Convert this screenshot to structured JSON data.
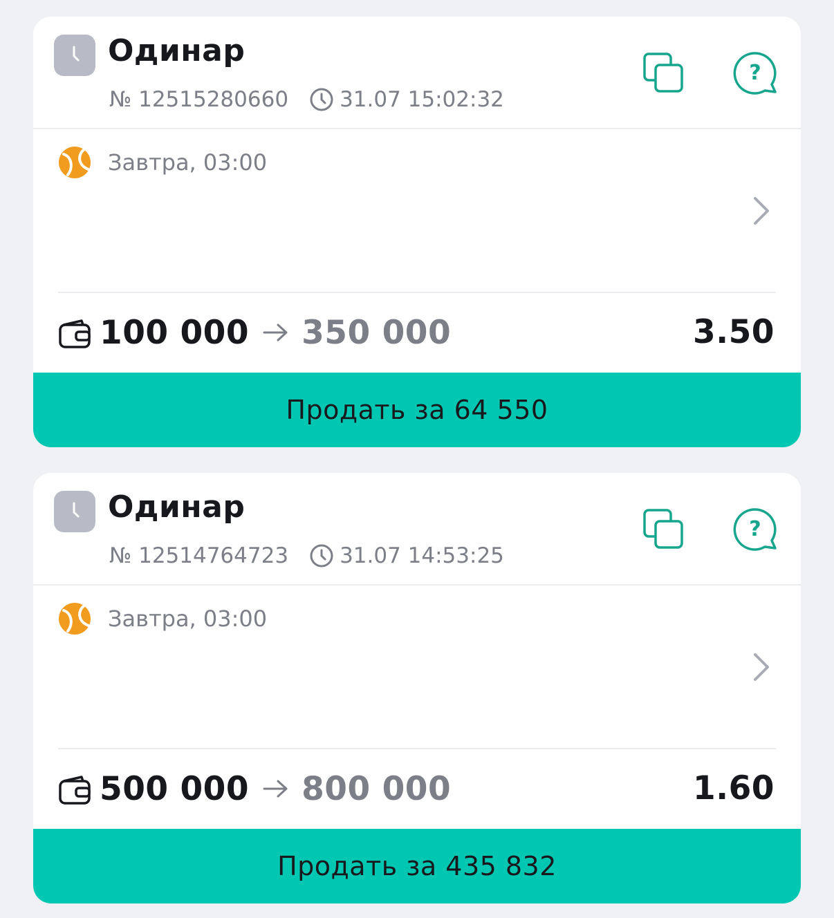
{
  "colors": {
    "background": "#f0f1f4",
    "card": "#ffffff",
    "accent": "#00c7b2",
    "icon_green": "#17a58e",
    "sport_orange": "#f29c1f",
    "muted_text": "#7c7f88",
    "status_badge": "#b8bbc5"
  },
  "bets": [
    {
      "type": "Одинар",
      "status_icon": "clock-pending-icon",
      "coupon_number": "№ 12515280660",
      "placed_at": "31.07 15:02:32",
      "sport_icon": "tennis-ball-icon",
      "event_time": "Завтра, 03:00",
      "stake": "100 000",
      "payout": "350 000",
      "odds": "3.50",
      "sell_label": "Продать за 64 550"
    },
    {
      "type": "Одинар",
      "status_icon": "clock-pending-icon",
      "coupon_number": "№ 12514764723",
      "placed_at": "31.07 14:53:25",
      "sport_icon": "tennis-ball-icon",
      "event_time": "Завтра, 03:00",
      "stake": "500 000",
      "payout": "800 000",
      "odds": "1.60",
      "sell_label": "Продать за 435 832"
    }
  ]
}
